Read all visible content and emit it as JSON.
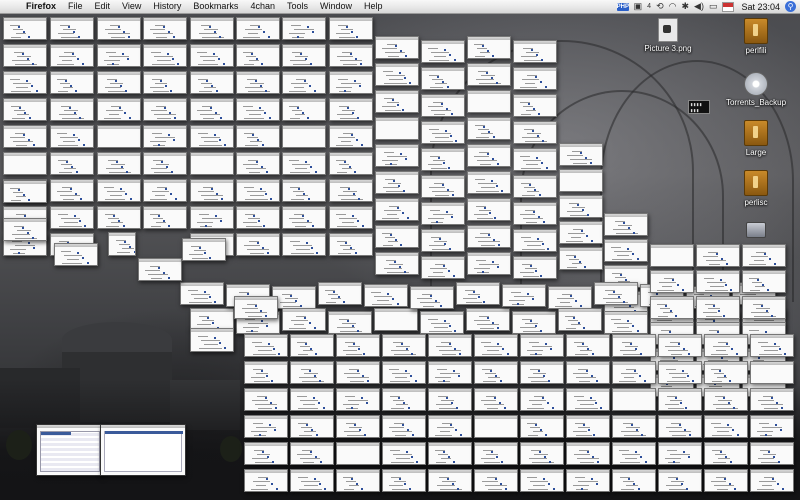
{
  "menubar": {
    "apple_label": "",
    "app_name": "Firefox",
    "menus": [
      "File",
      "Edit",
      "View",
      "History",
      "Bookmarks",
      "4chan",
      "Tools",
      "Window",
      "Help"
    ],
    "status": {
      "box_badge": "PHP",
      "menu_extra_count": "4",
      "clock": "Sat 23:04"
    }
  },
  "desktop_icons": [
    {
      "label": "Picture 3.png",
      "icon": "image-file-icon"
    },
    {
      "label": "perlfili",
      "icon": "package-icon"
    },
    {
      "label": "Torrents_Backup",
      "icon": "dvd-disc-icon"
    },
    {
      "label": "Large",
      "icon": "package-icon"
    },
    {
      "label": "perlisc",
      "icon": "package-icon"
    },
    {
      "label": "",
      "icon": "volume-icon"
    }
  ],
  "expose": {
    "description_note": "",
    "window_count_visible": "grid of many Firefox window thumbnails"
  },
  "colors": {
    "menubar_top": "#f8f8f8",
    "menubar_bottom": "#d6d6d6",
    "window_fill": "#fafafa",
    "window_border": "#777777",
    "accent_blue": "#2d4f9a"
  }
}
